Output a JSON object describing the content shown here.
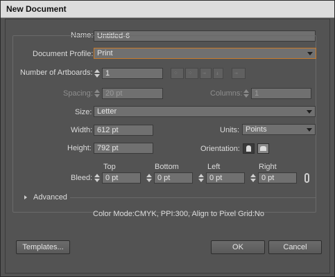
{
  "window": {
    "title": "New Document"
  },
  "form": {
    "name_label": "Name:",
    "name_value": "Untitled-6",
    "profile_label": "Document Profile:",
    "profile_value": "Print",
    "artboards_label": "Number of Artboards:",
    "artboards_value": "1",
    "spacing_label": "Spacing:",
    "spacing_value": "20 pt",
    "columns_label": "Columns:",
    "columns_value": "1",
    "size_label": "Size:",
    "size_value": "Letter",
    "width_label": "Width:",
    "width_value": "612 pt",
    "units_label": "Units:",
    "units_value": "Points",
    "height_label": "Height:",
    "height_value": "792 pt",
    "orientation_label": "Orientation:",
    "bleed_label": "Bleed:",
    "bleed": {
      "top_label": "Top",
      "top_value": "0 pt",
      "bottom_label": "Bottom",
      "bottom_value": "0 pt",
      "left_label": "Left",
      "left_value": "0 pt",
      "right_label": "Right",
      "right_value": "0 pt"
    },
    "advanced_label": "Advanced",
    "summary": "Color Mode:CMYK, PPI:300, Align to Pixel Grid:No"
  },
  "buttons": {
    "templates": "Templates...",
    "ok": "OK",
    "cancel": "Cancel"
  },
  "colors": {
    "dialog_bg": "#535353",
    "field_bg": "#707070",
    "focus_border": "#c97a2a",
    "title_bar": "#dcdcdc"
  },
  "icons": {
    "artboard_layout": [
      "grid-by-row-icon",
      "grid-by-column-icon",
      "arrange-by-row-icon",
      "arrange-by-column-icon",
      "change-to-right-to-left-icon"
    ],
    "orientation": [
      "portrait-icon",
      "landscape-icon"
    ],
    "bleed_link": "chain-link-icon"
  }
}
